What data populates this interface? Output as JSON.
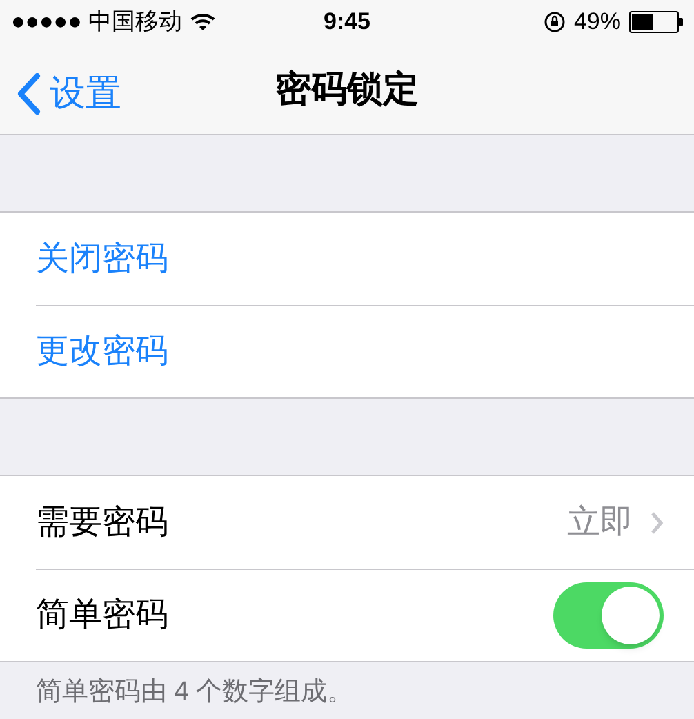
{
  "status_bar": {
    "carrier": "●●●●● 中国移动",
    "time": "9:45",
    "battery": "49%"
  },
  "nav": {
    "back": "设置",
    "title": "密码锁定"
  },
  "groups": [
    {
      "rows": [
        {
          "kind": "action",
          "label": "关闭密码"
        },
        {
          "kind": "action",
          "label": "更改密码"
        }
      ]
    },
    {
      "rows": [
        {
          "kind": "disclosure",
          "label": "需要密码",
          "value": "立即"
        },
        {
          "kind": "toggle",
          "label": "简单密码",
          "on": true
        }
      ],
      "footer": "简单密码由 4 个数字组成。"
    }
  ]
}
